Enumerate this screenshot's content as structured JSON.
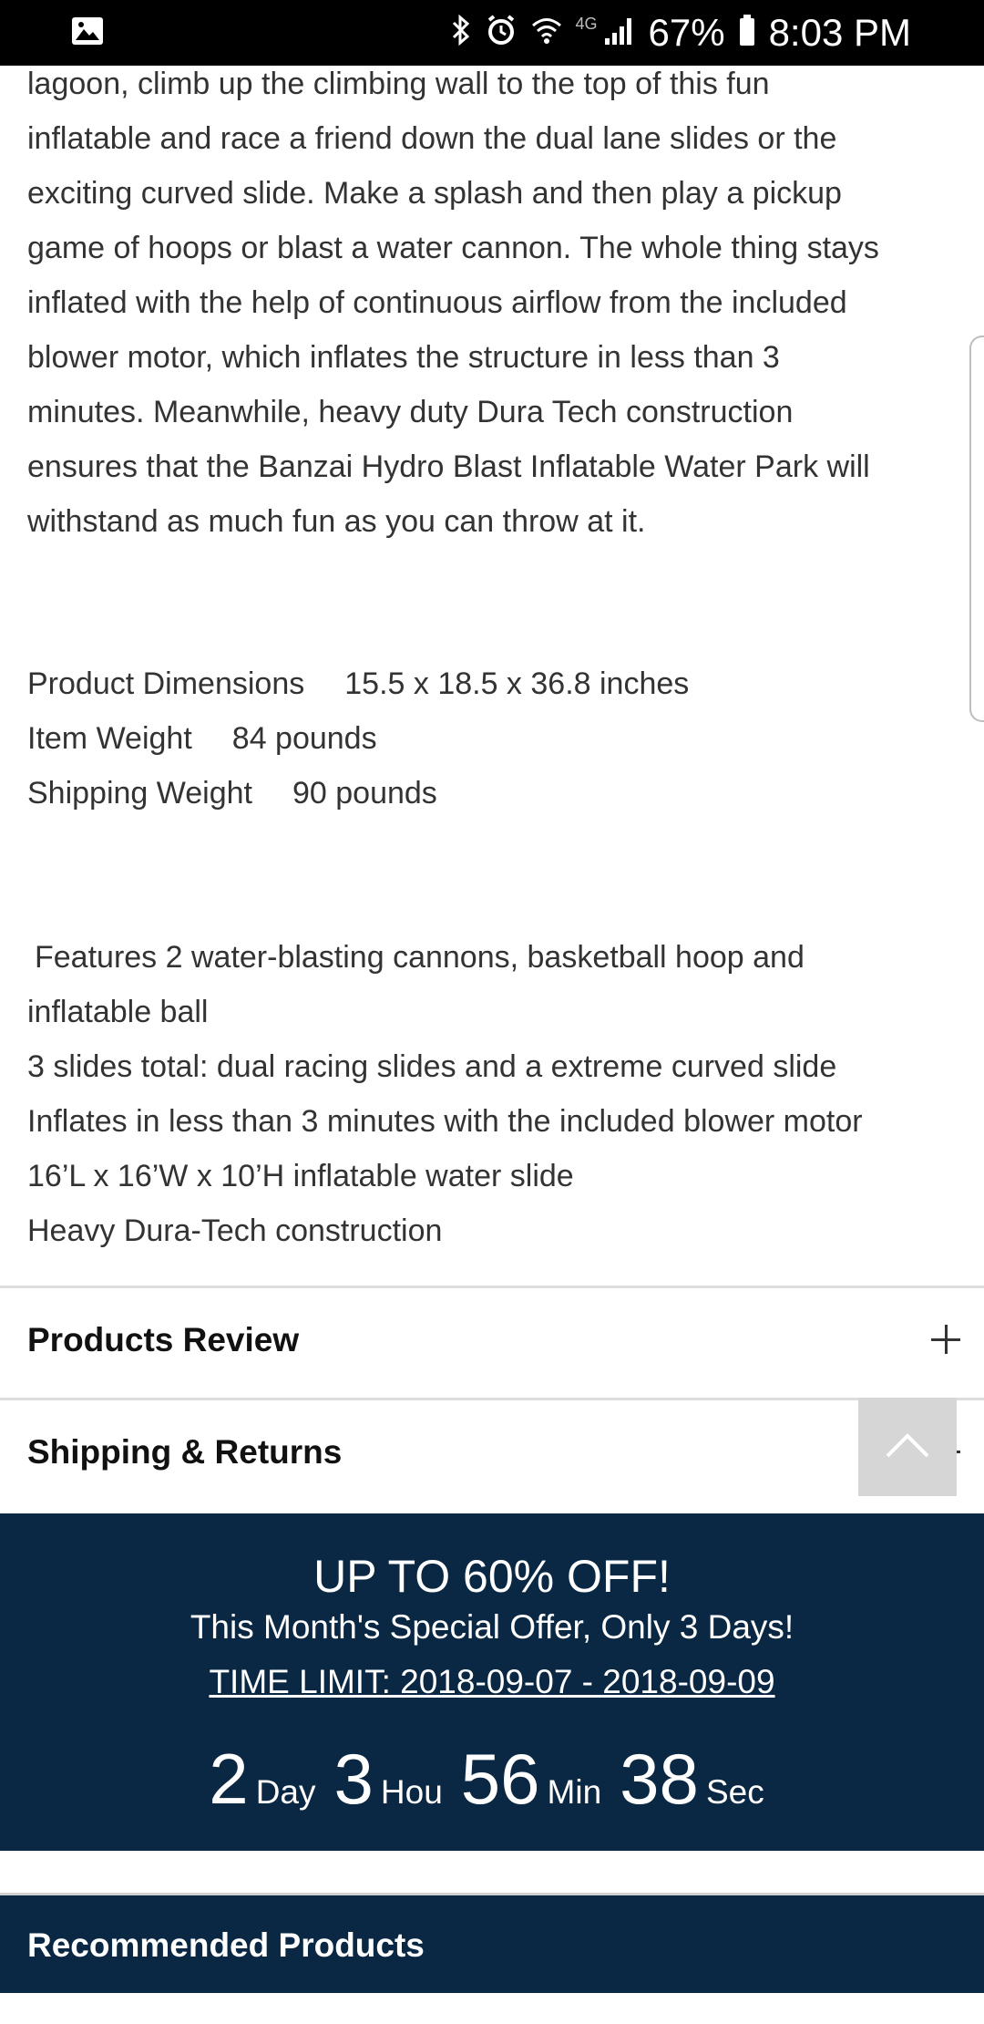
{
  "status_bar": {
    "network": "4G",
    "battery": "67%",
    "time": "8:03 PM"
  },
  "description": [
    "lagoon, climb up the climbing wall to the top of this fun",
    "inflatable and race a friend down the dual lane slides or the",
    "exciting curved slide. Make a splash and then play a pickup",
    "game of hoops or blast a water cannon. The whole thing stays",
    "inflated with the help of continuous airflow from the included",
    "blower motor, which inflates the structure in less than 3",
    "minutes. Meanwhile, heavy duty Dura Tech construction",
    "ensures that the Banzai Hydro Blast Inflatable Water Park will",
    "withstand as much fun as you can throw at it."
  ],
  "specs": [
    {
      "label": "Product Dimensions",
      "value": "15.5 x 18.5 x 36.8 inches"
    },
    {
      "label": "Item Weight",
      "value": "84 pounds"
    },
    {
      "label": "Shipping Weight",
      "value": "90 pounds"
    }
  ],
  "features": [
    "Features 2 water-blasting cannons, basketball hoop and",
    "inflatable ball",
    "3 slides total: dual racing slides and a extreme curved slide",
    "Inflates in less than 3 minutes with the included blower motor",
    "16’L x 16’W x 10’H inflatable water slide",
    "Heavy Dura-Tech construction"
  ],
  "accordions": {
    "review": "Products Review",
    "shipping": "Shipping & Returns"
  },
  "promo": {
    "title": "UP TO 60% OFF!",
    "subtitle": "This Month's Special Offer, Only 3 Days!",
    "time_limit": "TIME LIMIT: 2018-09-07 - 2018-09-09",
    "countdown": {
      "days": "2",
      "days_unit": "Day",
      "hours": "3",
      "hours_unit": "Hou",
      "minutes": "56",
      "minutes_unit": "Min",
      "seconds": "38",
      "seconds_unit": "Sec"
    }
  },
  "recommended": {
    "title": "Recommended Products"
  },
  "colors": {
    "promo_bg": "#0a2844",
    "text": "#333333"
  }
}
